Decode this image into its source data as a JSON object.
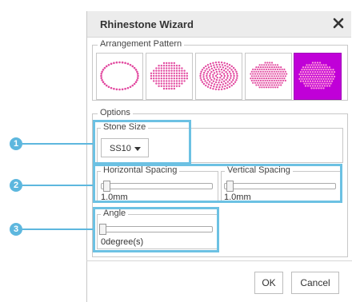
{
  "dialog": {
    "title": "Rhinestone Wizard",
    "close_icon": "close-icon"
  },
  "arrangement": {
    "legend": "Arrangement Pattern",
    "patterns": [
      {
        "name": "outline-ellipse",
        "selected": false
      },
      {
        "name": "filled-rect-grid",
        "selected": false
      },
      {
        "name": "concentric-fill",
        "selected": false
      },
      {
        "name": "dense-fill",
        "selected": false
      },
      {
        "name": "honeycomb-fill",
        "selected": true
      }
    ],
    "stone_color": "#e24aa0",
    "selected_bg": "#c000d8"
  },
  "options": {
    "legend": "Options",
    "stone_size": {
      "legend": "Stone Size",
      "value": "SS10"
    },
    "horizontal_spacing": {
      "legend": "Horizontal Spacing",
      "value": "1.0mm",
      "level": 0.0
    },
    "vertical_spacing": {
      "legend": "Vertical Spacing",
      "value": "1.0mm",
      "level": 0.0
    },
    "angle": {
      "legend": "Angle",
      "value": "0degree(s)",
      "level": 0.0
    }
  },
  "callouts": [
    "1",
    "2",
    "3"
  ],
  "highlight_color": "#6cc1e3",
  "buttons": {
    "ok": "OK",
    "cancel": "Cancel"
  }
}
